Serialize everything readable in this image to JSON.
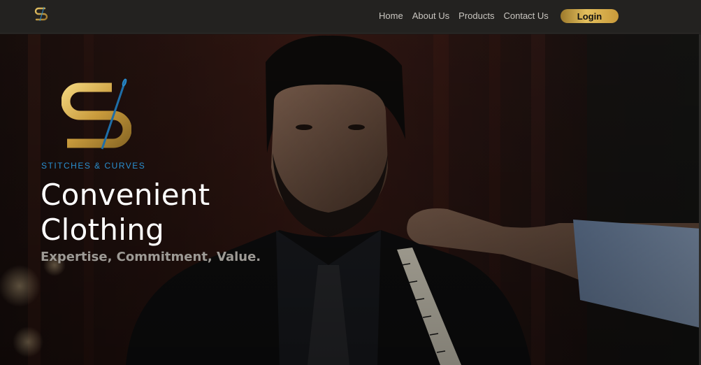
{
  "nav": {
    "logo_icon": "stitches-curves-logo-icon",
    "links": [
      "Home",
      "About Us",
      "Products",
      "Contact Us"
    ],
    "login_label": "Login"
  },
  "hero": {
    "logo_icon": "stitches-curves-needle-logo-icon",
    "brand_name": "STITCHES & CURVES",
    "title_line1": "Convenient",
    "title_line2": "Clothing",
    "tagline": "Expertise, Commitment, Value.",
    "image": "man-in-suit-being-measured-with-tape"
  },
  "colors": {
    "nav_bg": "#232220",
    "gold_accent": "#d4aa4a",
    "brand_blue": "#2a8fd0",
    "title_white": "#ffffff",
    "tagline_gray": "#9d9a95"
  }
}
